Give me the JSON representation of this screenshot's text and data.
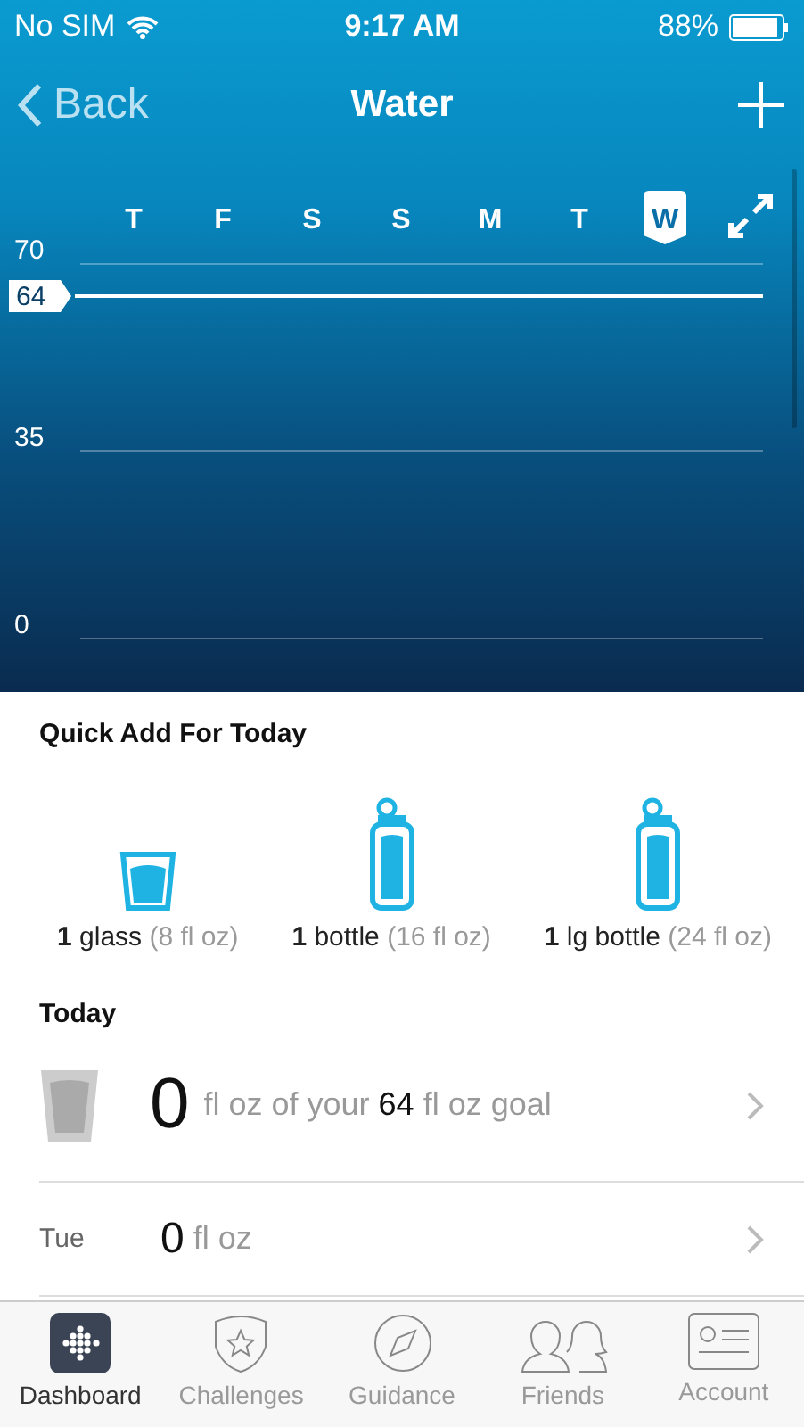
{
  "status_bar": {
    "carrier": "No SIM",
    "time": "9:17 AM",
    "battery": "88%"
  },
  "nav": {
    "back": "Back",
    "title": "Water"
  },
  "chart": {
    "days": [
      {
        "selected": false
      },
      {
        "selected": false
      },
      {
        "selected": false
      },
      {
        "selected": false
      },
      {
        "selected": false
      },
      {
        "selected": false
      },
      {
        "selected": true
      }
    ],
    "chart_data": {
      "type": "bar",
      "categories": [
        "T",
        "F",
        "S",
        "S",
        "M",
        "T",
        "W"
      ],
      "values": [
        0,
        0,
        0,
        0,
        0,
        0,
        0
      ],
      "ylim": [
        0,
        70
      ],
      "yticks": [
        0,
        35,
        70
      ],
      "ref_lines": [
        {
          "axis": "y",
          "value": 64,
          "label": "64"
        }
      ]
    }
  },
  "quick_add": {
    "title": "Quick Add For Today",
    "items": [
      {
        "kind": "glass",
        "count": "1",
        "name": "glass",
        "amount": "(8 fl oz)"
      },
      {
        "kind": "bottle",
        "count": "1",
        "name": "bottle",
        "amount": "(16 fl oz)"
      },
      {
        "kind": "bottle",
        "count": "1",
        "name": "lg bottle",
        "amount": "(24 fl oz)"
      }
    ]
  },
  "today": {
    "title": "Today",
    "value": "0",
    "text": "fl oz of your **64** fl oz goal"
  },
  "history": [
    {
      "day": "Tue",
      "value": "0",
      "unit": "fl oz"
    }
  ],
  "tab_bar": [
    {
      "kind": "dashboard",
      "label": "Dashboard",
      "selected": true
    },
    {
      "kind": "challenges",
      "label": "Challenges",
      "selected": false
    },
    {
      "kind": "guidance",
      "label": "Guidance",
      "selected": false
    },
    {
      "kind": "friends",
      "label": "Friends",
      "selected": false
    },
    {
      "kind": "account",
      "label": "Account",
      "selected": false
    }
  ]
}
